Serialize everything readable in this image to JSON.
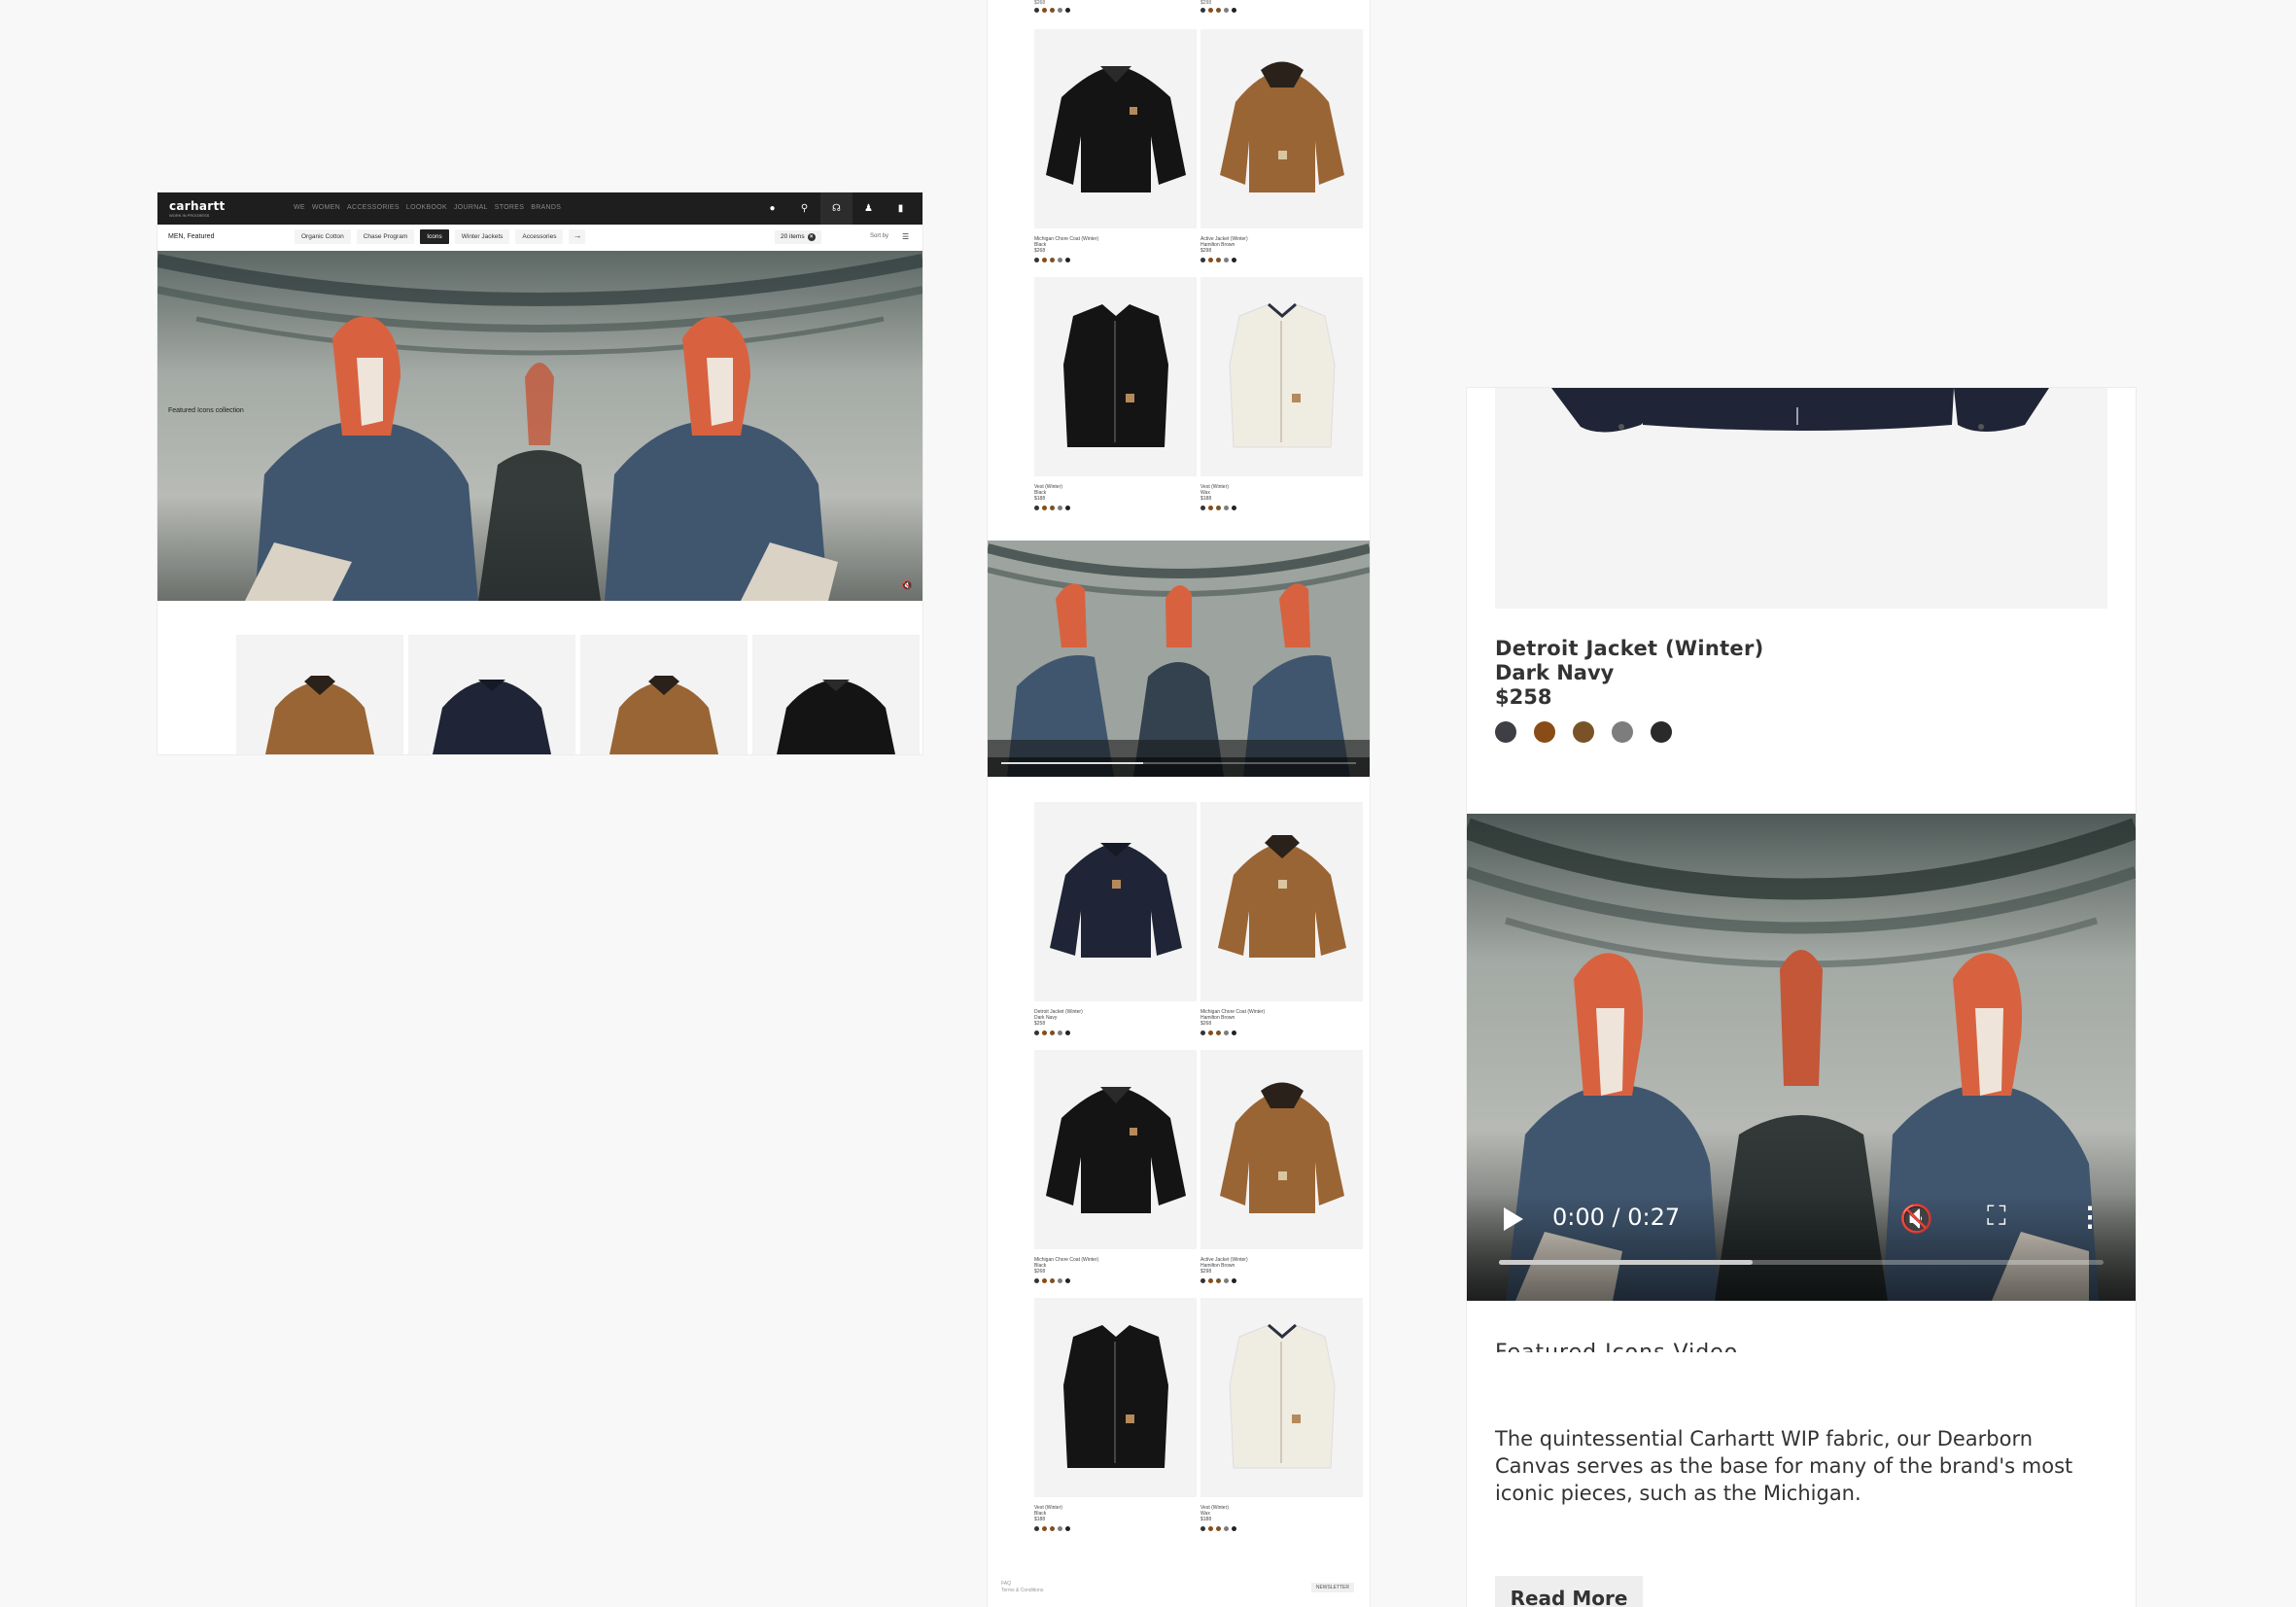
{
  "desktop": {
    "logo": "carhartt",
    "logo_sub": "WORK IN PROGRESS",
    "nav": [
      "WE",
      "WOMEN",
      "ACCESSORIES",
      "LOOKBOOK",
      "JOURNAL",
      "STORES",
      "BRANDS"
    ],
    "breadcrumb": "MEN, Featured",
    "chips": [
      "Organic Cotton",
      "Chase Program",
      "Icons",
      "Winter Jackets",
      "Accessories"
    ],
    "active_chip": "Icons",
    "items_count": "20 items",
    "sort": "Sort by",
    "hero_caption": "Featured Icons collection"
  },
  "scroll": {
    "products": [
      {
        "name": "Michigan Chore Coat (Winter)",
        "color": "Black",
        "price": "$268"
      },
      {
        "name": "Active Jacket (Winter)",
        "color": "Hamilton Brown",
        "price": "$298"
      },
      {
        "name": "Vest (Winter)",
        "color": "Black",
        "price": "$188"
      },
      {
        "name": "Vest (Winter)",
        "color": "Wax",
        "price": "$188"
      },
      {
        "name": "Detroit Jacket (Winter)",
        "color": "Dark Navy",
        "price": "$258"
      },
      {
        "name": "Michigan Chore Coat (Winter)",
        "color": "Hamilton Brown",
        "price": "$268"
      },
      {
        "name": "Michigan Chore Coat (Winter)",
        "color": "Black",
        "price": "$268"
      },
      {
        "name": "Active Jacket (Winter)",
        "color": "Hamilton Brown",
        "price": "$298"
      },
      {
        "name": "Vest (Winter)",
        "color": "Black",
        "price": "$188"
      },
      {
        "name": "Vest (Winter)",
        "color": "Wax",
        "price": "$188"
      }
    ],
    "footer_links": [
      "FAQ",
      "Terms & Conditions"
    ],
    "newsletter": "NEWSLETTER"
  },
  "mobile": {
    "product_name": "Detroit Jacket (Winter)",
    "product_color": "Dark Navy",
    "product_price": "$258",
    "swatches": [
      "#3d3f44",
      "#8a4c16",
      "#7a5228",
      "#7d7d7d",
      "#2a2a2a"
    ],
    "video_time": "0:00 / 0:27",
    "video_progress": 0.42,
    "video_heading": "Featured Icons Video",
    "description": "The quintessential Carhartt WIP fabric, our Dearborn Canvas serves as the base for many of the brand's most iconic pieces, such as the Michigan.",
    "read_more": "Read More"
  },
  "colors": {
    "brown_jacket": "#9a6534",
    "navy_jacket": "#1f2536",
    "black_jacket": "#141414",
    "wax_vest": "#efece2",
    "hood_orange": "#d8623f",
    "coat_blue": "#40566f",
    "topbar": "#1e1e1e"
  }
}
